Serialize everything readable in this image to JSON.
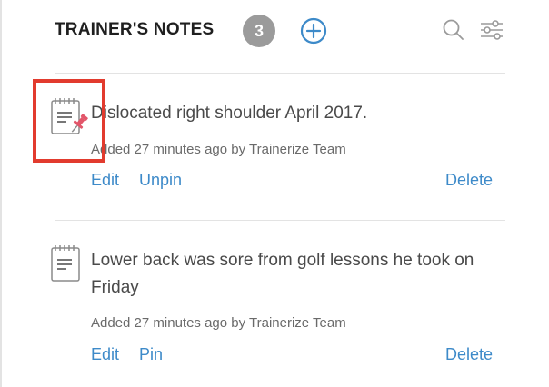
{
  "header": {
    "title": "TRAINER'S NOTES",
    "count": "3",
    "add_icon": "plus-circle-icon",
    "search_icon": "search-icon",
    "filter_icon": "sliders-icon"
  },
  "colors": {
    "accent": "#3d8ac9",
    "badge": "#9b9b9b",
    "highlight": "#e23b2e",
    "pin": "#e2566a"
  },
  "notes": [
    {
      "text": "Dislocated right shoulder April 2017.",
      "meta": "Added 27 minutes ago by Trainerize Team",
      "pinned": true,
      "icon": "notepad-pinned-icon",
      "actions": {
        "edit": "Edit",
        "pin_toggle": "Unpin",
        "delete": "Delete"
      }
    },
    {
      "text": "Lower back was sore from golf lessons he took on Friday",
      "meta": "Added 27 minutes ago by Trainerize Team",
      "pinned": false,
      "icon": "notepad-icon",
      "actions": {
        "edit": "Edit",
        "pin_toggle": "Pin",
        "delete": "Delete"
      }
    }
  ]
}
